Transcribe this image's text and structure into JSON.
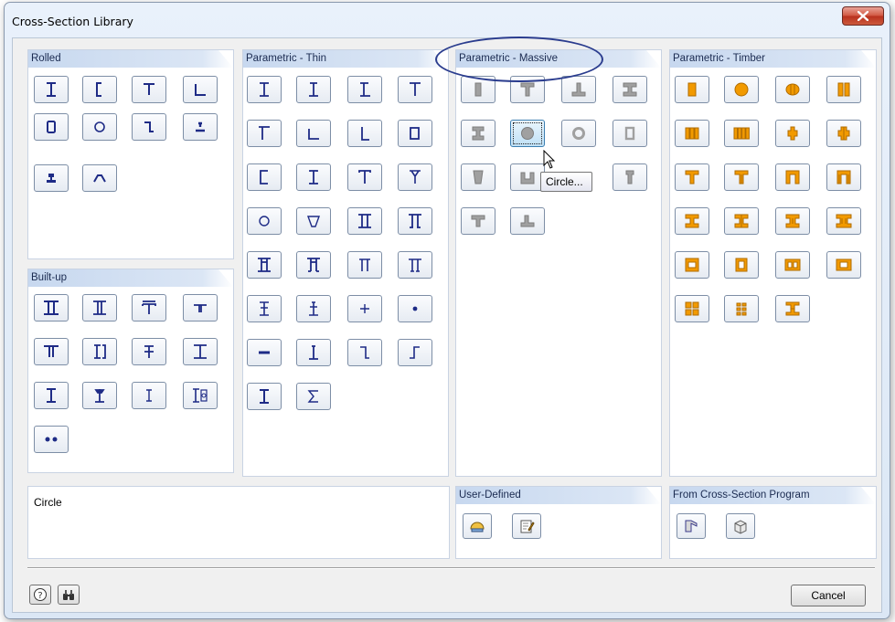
{
  "window": {
    "title": "Cross-Section Library"
  },
  "groups": {
    "rolled": "Rolled",
    "thin": "Parametric - Thin",
    "massive": "Parametric - Massive",
    "timber": "Parametric - Timber",
    "builtup": "Built-up",
    "userdefined": "User-Defined",
    "program": "From Cross-Section Program"
  },
  "rolled_icons": [
    "i-section",
    "channel",
    "t-section",
    "angle",
    "rect-hollow",
    "circle-hollow",
    "z-section",
    "rail",
    "crane-rail",
    "hat"
  ],
  "builtup_icons": [
    "double-i",
    "i-with-plate",
    "t-with-plate",
    "double-angle",
    "double-t",
    "i-channel",
    "i-lacing",
    "i-wide",
    "i-spaced",
    "i-haunched",
    "i-small",
    "i-box",
    "double-circle"
  ],
  "thin_icons": [
    "i-symmetric",
    "i-asymmetric",
    "i-flange",
    "t-thin",
    "t-inverse",
    "l-thin",
    "l-long",
    "box-thin",
    "channel-thin",
    "i-lipped",
    "t-lipped",
    "y-section",
    "circle-thin",
    "trapezoid-thin",
    "double-web",
    "double-web-tapered",
    "box-2cell",
    "box-2cell-tapered",
    "pi-section",
    "pi-wide",
    "cross-i",
    "cross-t",
    "plus",
    "dot",
    "bar",
    "tee-plate",
    "z-thin",
    "s-thin",
    "i-thin",
    "sigma"
  ],
  "massive_icons": [
    "rectangle",
    "t-massive",
    "inverted-t",
    "i-massive",
    "i-tapered",
    "circle",
    "annulus",
    "hollow-rect",
    "trapezoid",
    "u-massive",
    "t-fillet",
    "t-slab",
    "l-slab"
  ],
  "timber_icons": [
    "rect-timber",
    "circle-timber",
    "circle-split",
    "double-rect",
    "triple-rect",
    "quad-rect",
    "cross-timber",
    "cross-double",
    "t-timber",
    "t-timber-2",
    "pi-timber",
    "pi-timber-2",
    "i-timber",
    "i-timber-2",
    "i-timber-3",
    "i-timber-4",
    "box-timber",
    "box-timber-2",
    "box-timber-3",
    "box-timber-4",
    "grid-timber",
    "grid-timber-2",
    "i-glulam"
  ],
  "user_defined_icons": [
    "open-section-icon",
    "edit-section-icon"
  ],
  "program_icons": [
    "shape-thin-icon",
    "shape-massive-icon"
  ],
  "tooltip": "Circle...",
  "description": "Circle",
  "buttons": {
    "cancel": "Cancel",
    "help": "help-icon",
    "search": "binoculars-icon"
  },
  "colors": {
    "accent": "#2a3c8e",
    "icon": "#1e2b86",
    "massive_fill": "#a0a0a0",
    "timber_fill": "#f29a00"
  }
}
